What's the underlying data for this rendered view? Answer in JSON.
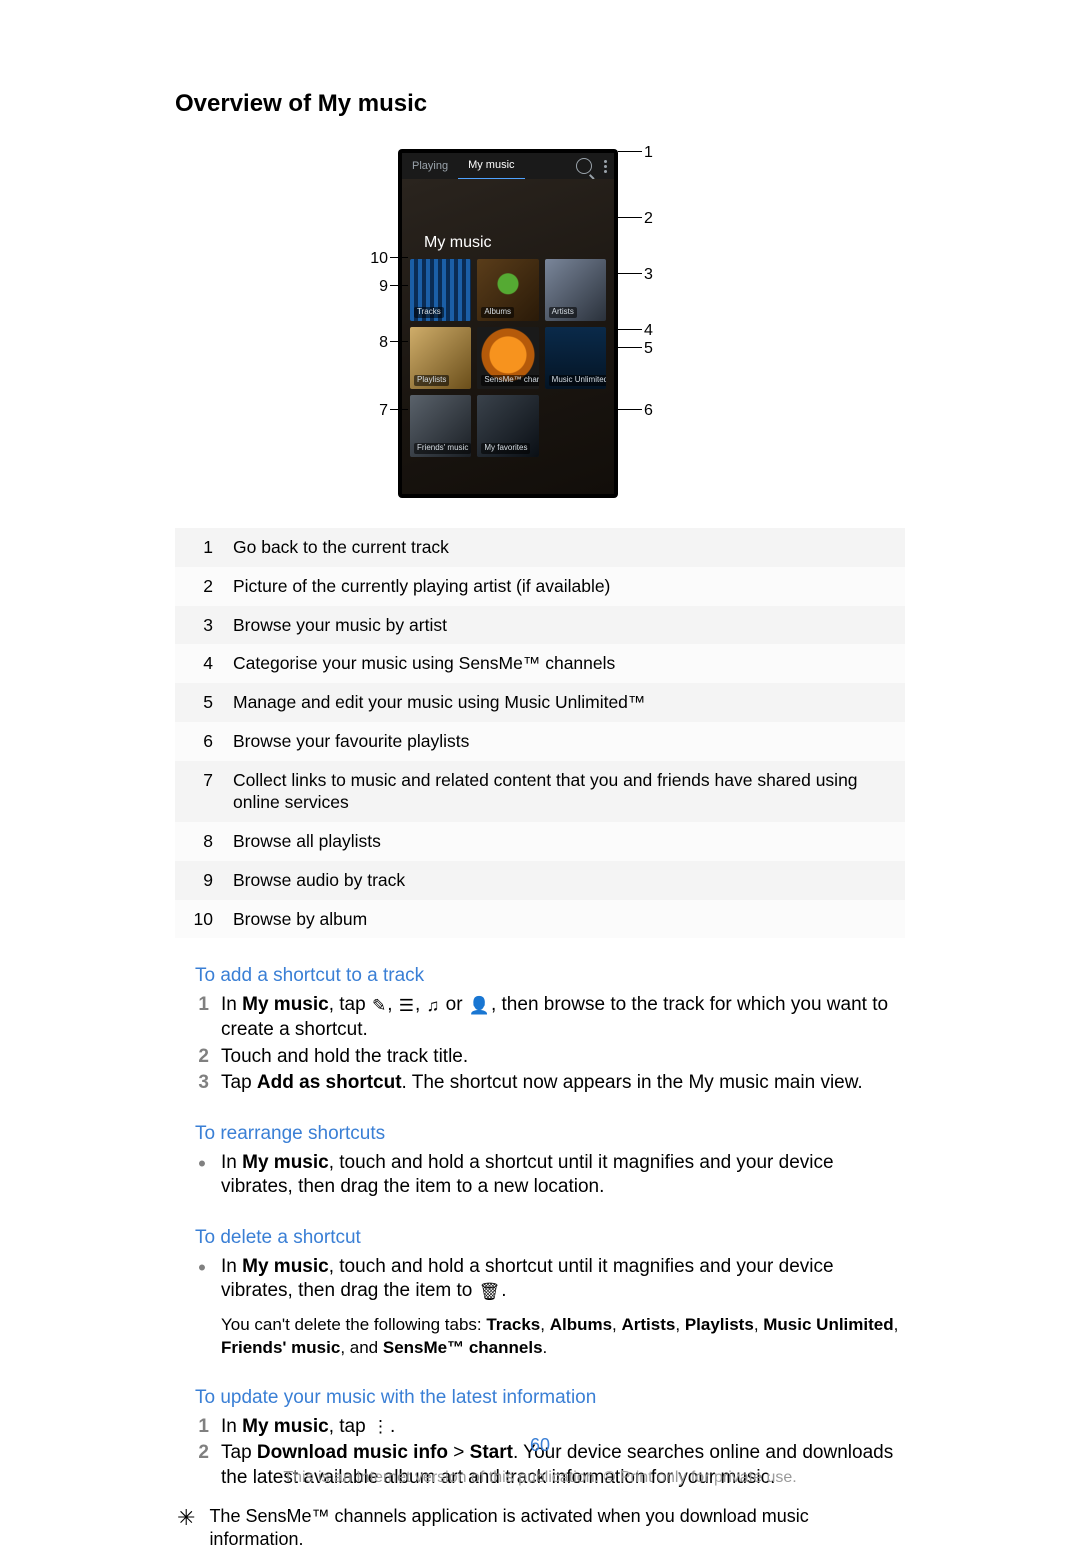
{
  "section_title": "Overview of My music",
  "figure": {
    "phone": {
      "tab_playing": "Playing",
      "tab_mymusic": "My music",
      "heading": "My music",
      "tiles": [
        "Tracks",
        "Albums",
        "Artists",
        "Playlists",
        "SensMe™ channels",
        "Music Unlimited",
        "Friends' music",
        "My favorites"
      ]
    },
    "callouts_right": [
      "1",
      "2",
      "3",
      "4",
      "5",
      "6"
    ],
    "callouts_left": [
      "10",
      "9",
      "8",
      "7"
    ]
  },
  "legend": [
    {
      "n": "1",
      "t": "Go back to the current track"
    },
    {
      "n": "2",
      "t": "Picture of the currently playing artist (if available)"
    },
    {
      "n": "3",
      "t": "Browse your music by artist"
    },
    {
      "n": "4",
      "t": "Categorise your music using SensMe™ channels"
    },
    {
      "n": "5",
      "t": "Manage and edit your music using Music Unlimited™"
    },
    {
      "n": "6",
      "t": "Browse your favourite playlists"
    },
    {
      "n": "7",
      "t": "Collect links to music and related content that you and friends have shared using online services"
    },
    {
      "n": "8",
      "t": "Browse all playlists"
    },
    {
      "n": "9",
      "t": "Browse audio by track"
    },
    {
      "n": "10",
      "t": "Browse by album"
    }
  ],
  "sub_add": "To add a shortcut to a track",
  "steps_add": {
    "s1a": "In ",
    "s1b": "My music",
    "s1c": ", tap ",
    "s1_icons": {
      "artist": "👤",
      "playlist": "≔",
      "track": "♫",
      "person": "▲"
    },
    "s1d": ", then browse to the track for which you want to create a shortcut.",
    "s2": "Touch and hold the track title.",
    "s3a": "Tap ",
    "s3b": "Add as shortcut",
    "s3c": ". The shortcut now appears in the My music main view."
  },
  "sub_rearr": "To rearrange shortcuts",
  "steps_rearr": {
    "a": "In ",
    "b": "My music",
    "c": ", touch and hold a shortcut until it magnifies and your device vibrates, then drag the item to a new location."
  },
  "sub_del": "To delete a shortcut",
  "steps_del": {
    "a": "In ",
    "b": "My music",
    "c": ", touch and hold a shortcut until it magnifies and your device vibrates, then drag the item to ",
    "trash": "🗑",
    "d": "."
  },
  "note_del_a": "You can't delete the following tabs: ",
  "note_del_tabs": [
    "Tracks",
    "Albums",
    "Artists",
    "Playlists",
    "Music Unlimited",
    "Friends' music",
    "SensMe™ channels"
  ],
  "note_del_and": " and ",
  "sub_update": "To update your music with the latest information",
  "steps_update": {
    "s1a": "In ",
    "s1b": "My music",
    "s1c": ", tap ",
    "menu": "⋮",
    "s1d": ".",
    "s2a": "Tap ",
    "s2b": "Download music info",
    "s2c": " > ",
    "s2d": "Start",
    "s2e": ". Your device searches online and downloads the latest available album art and track information for your music."
  },
  "tip": "The SensMe™ channels application is activated when you download music information.",
  "page_num": "60",
  "footer": "This is an Internet version of this publication. © Print only for private use."
}
